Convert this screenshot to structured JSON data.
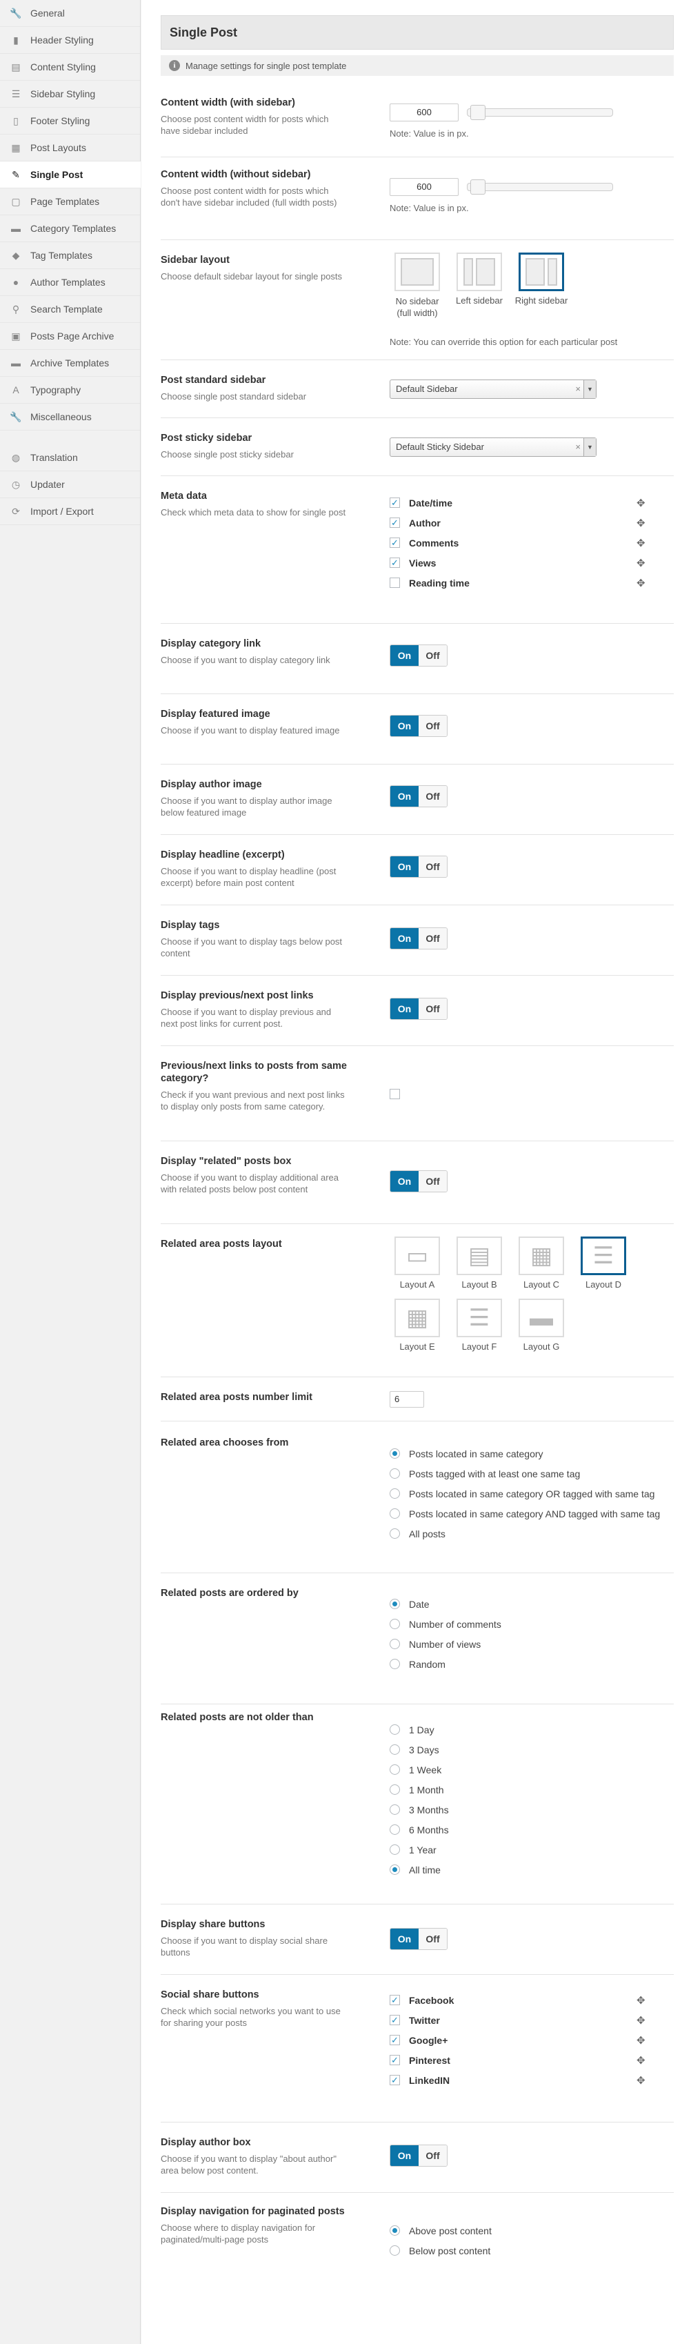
{
  "sidebar": {
    "items": [
      {
        "label": "General",
        "icon": "wrench-icon",
        "glyph": "🔧"
      },
      {
        "label": "Header Styling",
        "icon": "bookmark-icon",
        "glyph": "▮"
      },
      {
        "label": "Content Styling",
        "icon": "document-icon",
        "glyph": "▤"
      },
      {
        "label": "Sidebar Styling",
        "icon": "list-icon",
        "glyph": "☰"
      },
      {
        "label": "Footer Styling",
        "icon": "bookmark-outline-icon",
        "glyph": "▯"
      },
      {
        "label": "Post Layouts",
        "icon": "grid-icon",
        "glyph": "▦"
      },
      {
        "label": "Single Post",
        "icon": "pencil-icon",
        "glyph": "✎"
      },
      {
        "label": "Page Templates",
        "icon": "page-icon",
        "glyph": "▢"
      },
      {
        "label": "Category Templates",
        "icon": "folder-icon",
        "glyph": "▬"
      },
      {
        "label": "Tag Templates",
        "icon": "tag-icon",
        "glyph": "◆"
      },
      {
        "label": "Author Templates",
        "icon": "user-icon",
        "glyph": "●"
      },
      {
        "label": "Search Template",
        "icon": "search-icon",
        "glyph": "⚲"
      },
      {
        "label": "Posts Page Archive",
        "icon": "archive-icon",
        "glyph": "▣"
      },
      {
        "label": "Archive Templates",
        "icon": "folder-icon",
        "glyph": "▬"
      },
      {
        "label": "Typography",
        "icon": "typography-icon",
        "glyph": "A"
      },
      {
        "label": "Miscellaneous",
        "icon": "wrench-icon",
        "glyph": "🔧"
      },
      {
        "label": "Translation",
        "icon": "globe-icon",
        "glyph": "◍"
      },
      {
        "label": "Updater",
        "icon": "clock-icon",
        "glyph": "◷"
      },
      {
        "label": "Import / Export",
        "icon": "refresh-icon",
        "glyph": "⟳"
      }
    ]
  },
  "panel": {
    "title": "Single Post",
    "description": "Manage settings for single post template"
  },
  "content_width_sidebar": {
    "title": "Content width (with sidebar)",
    "desc": "Choose post content width for posts which have sidebar included",
    "value": "600",
    "note": "Note: Value is in px."
  },
  "content_width_nosidebar": {
    "title": "Content width (without sidebar)",
    "desc": "Choose post content width for posts which don't have sidebar included (full width posts)",
    "value": "600",
    "note": "Note: Value is in px."
  },
  "sidebar_layout": {
    "title": "Sidebar layout",
    "desc": "Choose default sidebar layout for single posts",
    "options": [
      "No sidebar (full width)",
      "Left sidebar",
      "Right sidebar"
    ],
    "selected": "Right sidebar",
    "note": "Note: You can override this option for each particular post"
  },
  "standard_sidebar": {
    "title": "Post standard sidebar",
    "desc": "Choose single post standard sidebar",
    "value": "Default Sidebar"
  },
  "sticky_sidebar": {
    "title": "Post sticky sidebar",
    "desc": "Choose single post sticky sidebar",
    "value": "Default Sticky Sidebar"
  },
  "meta_data": {
    "title": "Meta data",
    "desc": "Check which meta data to show for single post",
    "items": [
      {
        "label": "Date/time",
        "checked": true
      },
      {
        "label": "Author",
        "checked": true
      },
      {
        "label": "Comments",
        "checked": true
      },
      {
        "label": "Views",
        "checked": true
      },
      {
        "label": "Reading time",
        "checked": false
      }
    ]
  },
  "toggle": {
    "on": "On",
    "off": "Off"
  },
  "category_link": {
    "title": "Display category link",
    "desc": "Choose if you want to display category link"
  },
  "featured_image": {
    "title": "Display featured image",
    "desc": "Choose if you want to display featured image"
  },
  "author_image": {
    "title": "Display author image",
    "desc": "Choose if you want to display author image below featured image"
  },
  "headline": {
    "title": "Display headline (excerpt)",
    "desc": "Choose if you want to display headline (post excerpt) before main post content"
  },
  "tags": {
    "title": "Display tags",
    "desc": "Choose if you want to display tags below post content"
  },
  "prev_next": {
    "title": "Display previous/next post links",
    "desc": "Choose if you want to display previous and next post links for current post."
  },
  "prev_next_same": {
    "title": "Previous/next links to posts from same category?",
    "desc": "Check if you want previous and next post links to display only posts from same category.",
    "checked": false
  },
  "related_box": {
    "title": "Display \"related\" posts box",
    "desc": "Choose if you want to display additional area with related posts below post content"
  },
  "related_layout": {
    "title": "Related area posts layout",
    "options": [
      "Layout A",
      "Layout B",
      "Layout C",
      "Layout D",
      "Layout E",
      "Layout F",
      "Layout G"
    ],
    "selected": "Layout D"
  },
  "related_limit": {
    "title": "Related area posts number limit",
    "value": "6"
  },
  "related_from": {
    "title": "Related area chooses from",
    "options": [
      "Posts located in same category",
      "Posts tagged with at least one same tag",
      "Posts located in same category OR tagged with same tag",
      "Posts located in same category AND tagged with same tag",
      "All posts"
    ],
    "selected": "Posts located in same category"
  },
  "related_order": {
    "title": "Related posts are ordered by",
    "options": [
      "Date",
      "Number of comments",
      "Number of views",
      "Random"
    ],
    "selected": "Date"
  },
  "related_age": {
    "title": "Related posts are not older than",
    "options": [
      "1 Day",
      "3 Days",
      "1 Week",
      "1 Month",
      "3 Months",
      "6 Months",
      "1 Year",
      "All time"
    ],
    "selected": "All time"
  },
  "share_buttons": {
    "title": "Display share buttons",
    "desc": "Choose if you want to display social share buttons"
  },
  "social_share": {
    "title": "Social share buttons",
    "desc": "Check which social networks you want to use for sharing your posts",
    "items": [
      {
        "label": "Facebook",
        "checked": true
      },
      {
        "label": "Twitter",
        "checked": true
      },
      {
        "label": "Google+",
        "checked": true
      },
      {
        "label": "Pinterest",
        "checked": true
      },
      {
        "label": "LinkedIN",
        "checked": true
      }
    ]
  },
  "author_box": {
    "title": "Display author box",
    "desc": "Choose if you want to display \"about author\" area below post content."
  },
  "pagination_nav": {
    "title": "Display navigation for paginated posts",
    "desc": "Choose where to display navigation for paginated/multi-page posts",
    "options": [
      "Above post content",
      "Below post content"
    ],
    "selected": "Above post content"
  },
  "colors": {
    "accent": "#0b74a8",
    "checkmark": "#1e8cbe",
    "selected_border": "#0b5e91"
  }
}
